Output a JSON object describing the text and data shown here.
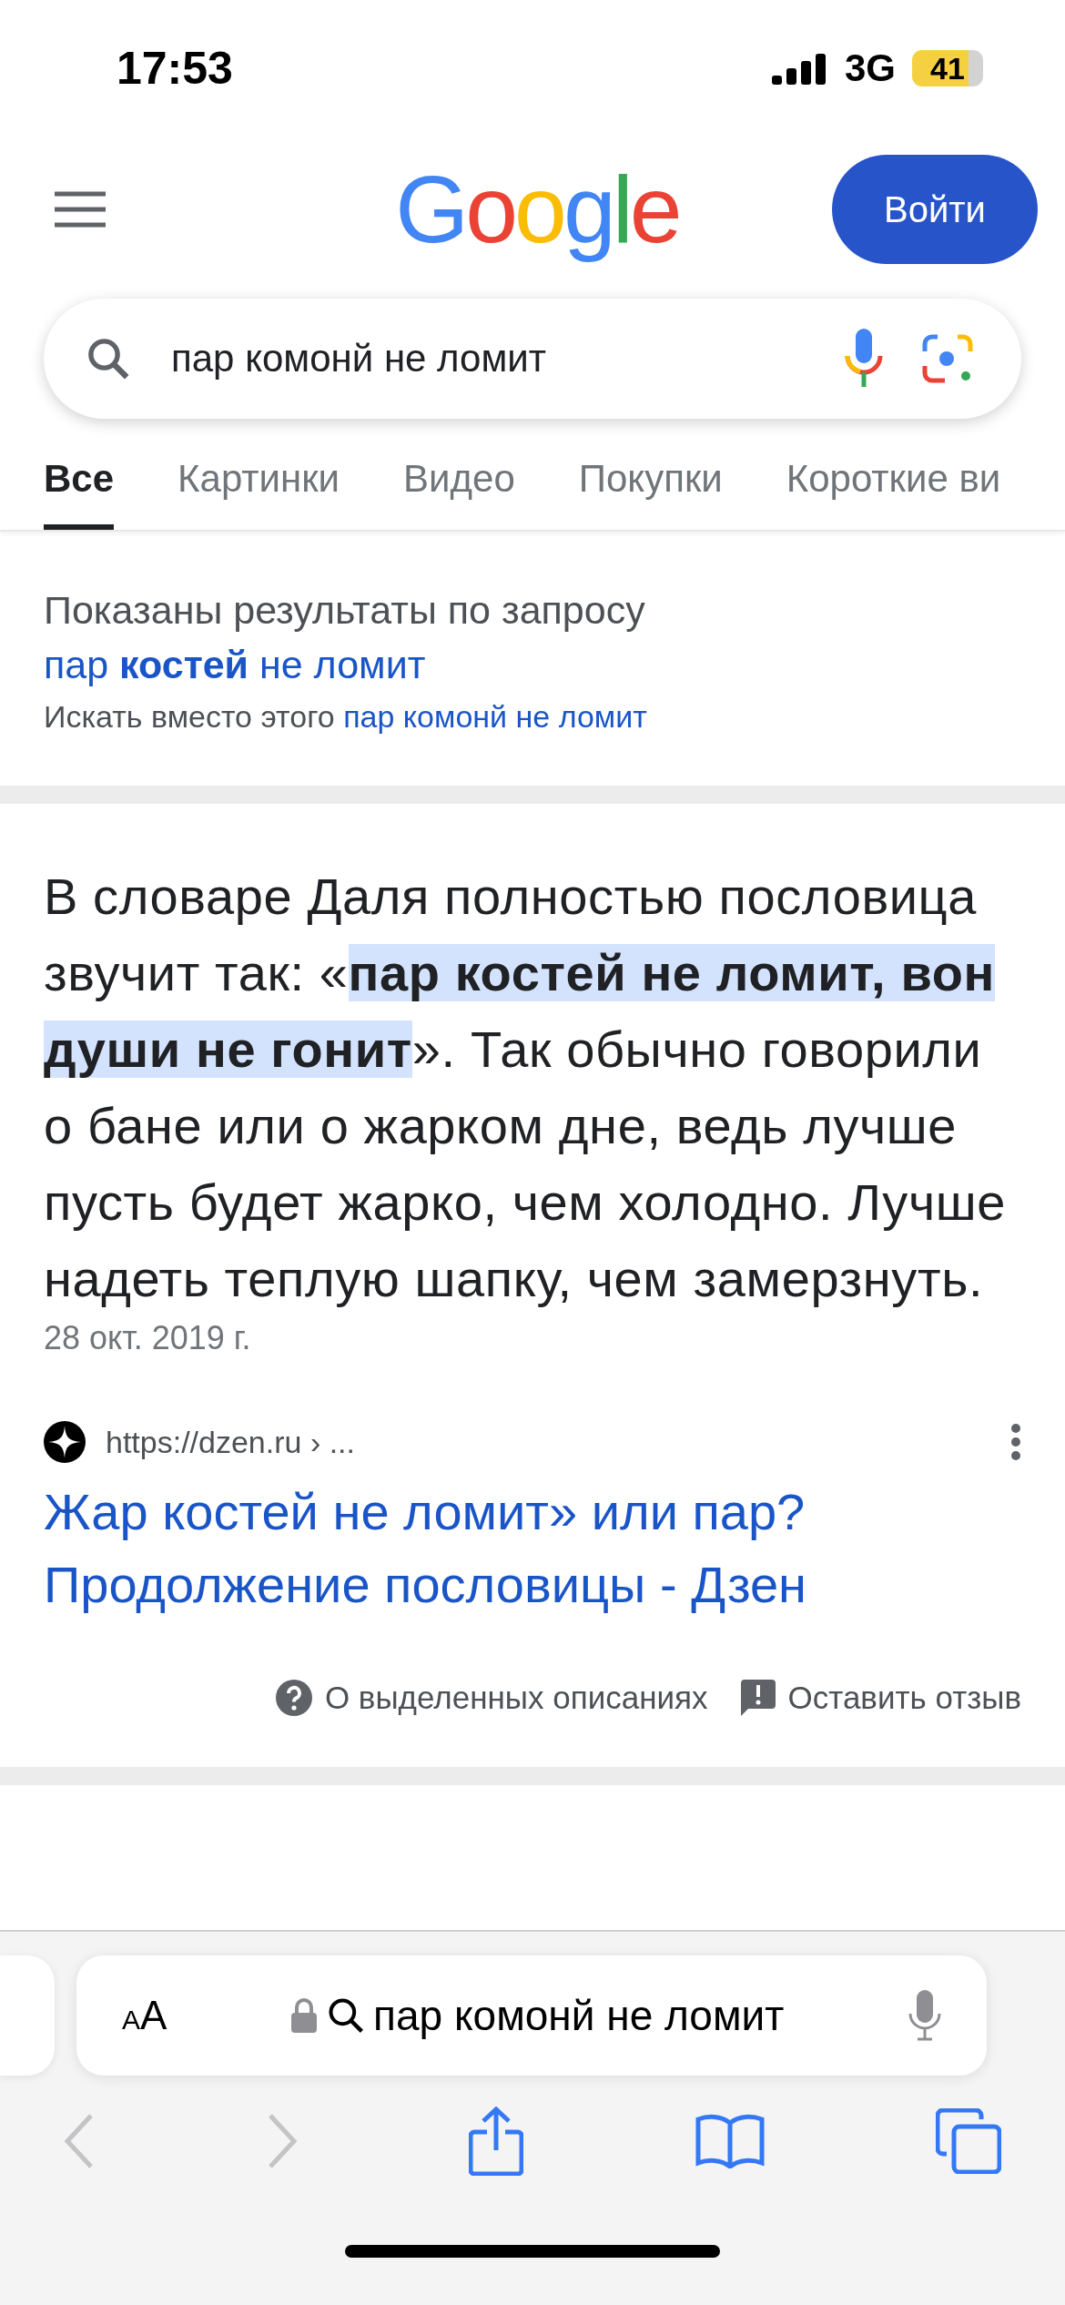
{
  "status_bar": {
    "time": "17:53",
    "network": "3G",
    "battery": "41"
  },
  "header": {
    "logo": "Google",
    "sign_in": "Войти"
  },
  "search": {
    "value": "пар комонй не ломит"
  },
  "tabs": [
    {
      "label": "Все",
      "selected": true
    },
    {
      "label": "Картинки",
      "selected": false
    },
    {
      "label": "Видео",
      "selected": false
    },
    {
      "label": "Покупки",
      "selected": false
    },
    {
      "label": "Короткие ви",
      "selected": false
    }
  ],
  "correction": {
    "text": "Показаны результаты по запросу",
    "link": "пар **костей** не ломит",
    "alt_text": "Искать вместо этого",
    "alt_link": "пар комонй не ломит"
  },
  "snippet": {
    "parts": [
      {
        "text": "В словаре Даля полностью пословица звучит так: «",
        "highlighted": false
      },
      {
        "text": "пар костей не ломит, вон души не гонит",
        "highlighted": true
      },
      {
        "text": "». Так обычно говорили о бане или о жарком дне, ведь лучше пусть будет жарко, чем холодно. Лучше надеть теплую шапку, чем замерзнуть.",
        "highlighted": false
      }
    ],
    "date": "28 окт. 2019 г.",
    "source_url": "https://dzen.ru › ...",
    "title": "Жар костей не ломит» или пар? Продолжение пословицы - Дзен",
    "about": "О выделенных описаниях",
    "feedback": "Оставить отзыв"
  },
  "browser": {
    "text_size": "AA",
    "address": "пар комонй не ломит"
  }
}
